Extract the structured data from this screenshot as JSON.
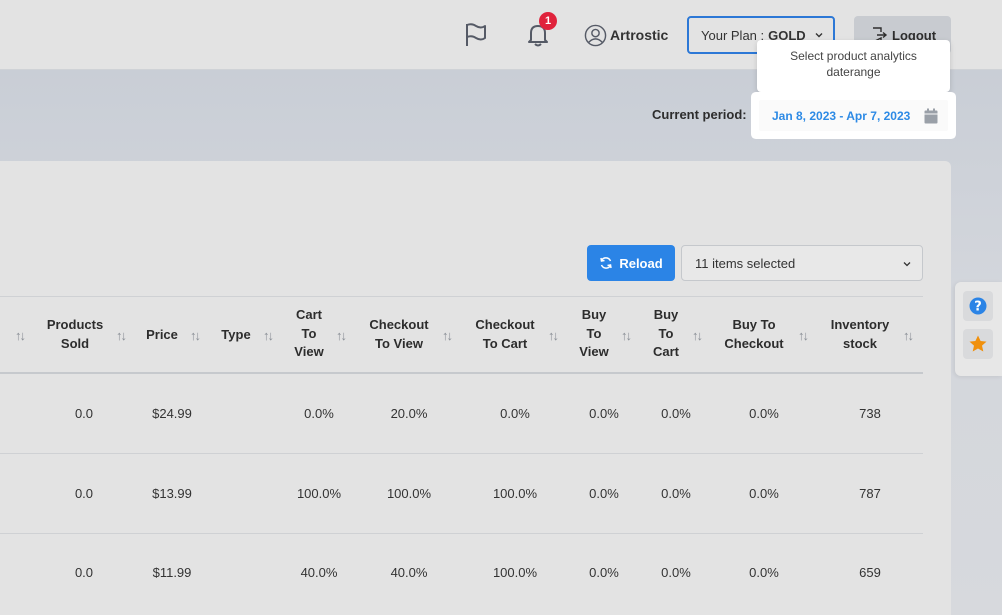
{
  "header": {
    "notification_count": "1",
    "username": "Artrostic",
    "plan_prefix": "Your Plan :",
    "plan_name": "GOLD",
    "logout_label": "Logout"
  },
  "tooltip": {
    "text": "Select product analytics daterange"
  },
  "period": {
    "label": "Current period:",
    "value": "Jan 8, 2023 - Apr 7, 2023"
  },
  "toolbar": {
    "reload_label": "Reload",
    "items_selected": "11 items selected"
  },
  "table": {
    "columns": [
      {
        "label": "Products Sold"
      },
      {
        "label": "Price"
      },
      {
        "label": "Type"
      },
      {
        "label": "Cart To View"
      },
      {
        "label": "Checkout To View"
      },
      {
        "label": "Checkout To Cart"
      },
      {
        "label": "Buy To View"
      },
      {
        "label": "Buy To Cart"
      },
      {
        "label": "Buy To Checkout"
      },
      {
        "label": "Inventory stock"
      }
    ],
    "rows": [
      [
        "0.0",
        "$24.99",
        "",
        "0.0%",
        "20.0%",
        "0.0%",
        "0.0%",
        "0.0%",
        "0.0%",
        "738"
      ],
      [
        "0.0",
        "$13.99",
        "",
        "100.0%",
        "100.0%",
        "100.0%",
        "0.0%",
        "0.0%",
        "0.0%",
        "787"
      ],
      [
        "0.0",
        "$11.99",
        "",
        "40.0%",
        "40.0%",
        "100.0%",
        "0.0%",
        "0.0%",
        "0.0%",
        "659"
      ]
    ]
  },
  "colors": {
    "accent": "#2b84e6",
    "badge": "#e0233c",
    "date_text": "#2d8ae5",
    "star": "#f0900c"
  },
  "icons": [
    "flag-icon",
    "bell-icon",
    "user-icon",
    "chevron-down-icon",
    "logout-icon",
    "calendar-icon",
    "refresh-icon",
    "help-icon",
    "star-icon",
    "sort-icon"
  ]
}
